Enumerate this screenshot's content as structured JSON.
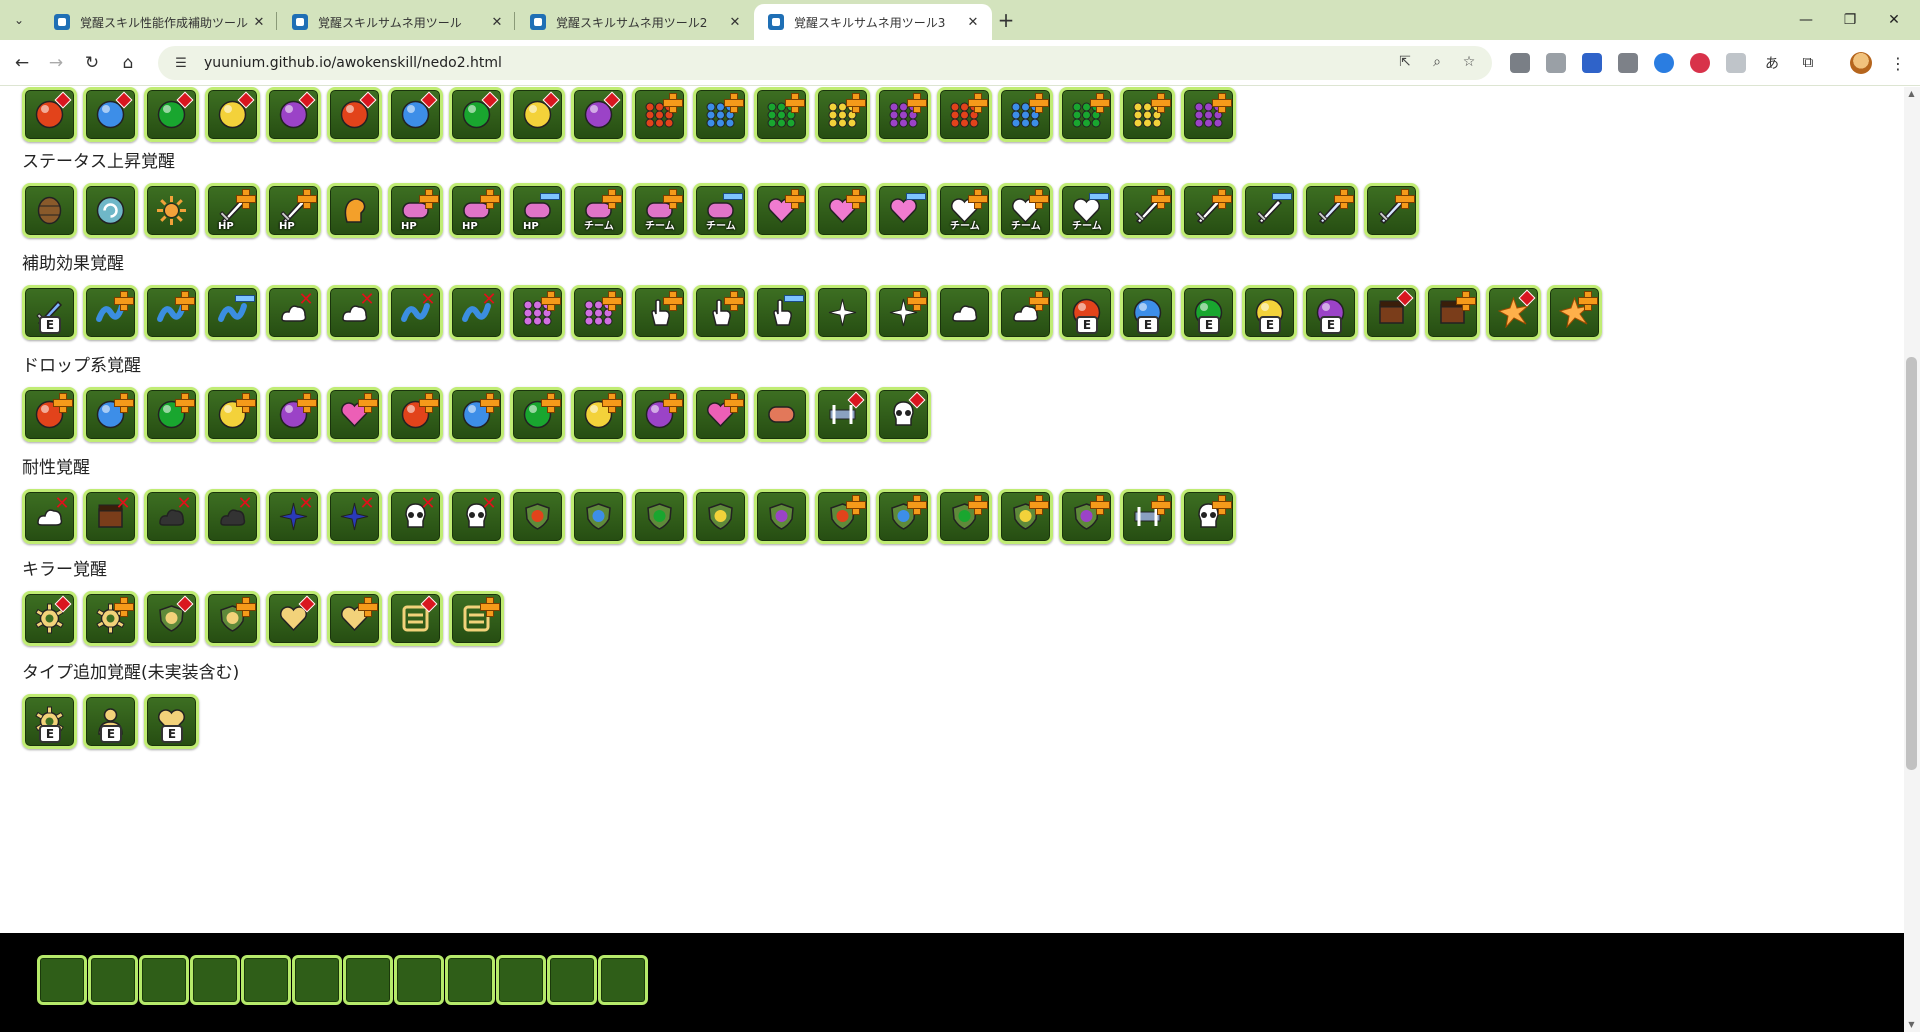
{
  "browser": {
    "tabs": [
      {
        "title": "覚醒スキル性能作成補助ツール",
        "active": false
      },
      {
        "title": "覚醒スキルサムネ用ツール",
        "active": false
      },
      {
        "title": "覚醒スキルサムネ用ツール2",
        "active": false
      },
      {
        "title": "覚醒スキルサムネ用ツール3",
        "active": true
      }
    ],
    "close_glyph": "✕",
    "new_tab_glyph": "+",
    "url": "yuunium.github.io/awokenskill/nedo2.html",
    "icons": [
      "back-icon",
      "forward-icon",
      "reload-icon",
      "home-icon",
      "site-info-icon",
      "open-in-app-icon",
      "zoom-icon",
      "bookmark-star-icon",
      "extensions-icon",
      "profile-avatar",
      "more-menu-icon"
    ],
    "window_controls": [
      "—",
      "❐",
      "✕"
    ]
  },
  "sections": [
    {
      "title": "",
      "key": "top",
      "icons": [
        {
          "kind": "orb",
          "color": "#e2431b",
          "mark": "diamond"
        },
        {
          "kind": "orb",
          "color": "#3d8ee8",
          "mark": "diamond"
        },
        {
          "kind": "orb",
          "color": "#19a62f",
          "mark": "diamond"
        },
        {
          "kind": "orb",
          "color": "#f3d23a",
          "mark": "diamond"
        },
        {
          "kind": "orb",
          "color": "#9b43c7",
          "mark": "diamond"
        },
        {
          "kind": "orb",
          "color": "#e2431b",
          "mark": "diamond"
        },
        {
          "kind": "orb",
          "color": "#3d8ee8",
          "mark": "diamond"
        },
        {
          "kind": "orb",
          "color": "#19a62f",
          "mark": "diamond"
        },
        {
          "kind": "orb",
          "color": "#f3d23a",
          "mark": "diamond"
        },
        {
          "kind": "orb",
          "color": "#9b43c7",
          "mark": "diamond"
        },
        {
          "kind": "dots",
          "color": "#e2431b",
          "mark": "plus"
        },
        {
          "kind": "dots",
          "color": "#3d8ee8",
          "mark": "plus"
        },
        {
          "kind": "dots",
          "color": "#19a62f",
          "mark": "plus"
        },
        {
          "kind": "dots",
          "color": "#f3d23a",
          "mark": "plus"
        },
        {
          "kind": "dots",
          "color": "#9b43c7",
          "mark": "plus"
        },
        {
          "kind": "dots",
          "color": "#e2431b",
          "mark": "plus"
        },
        {
          "kind": "dots",
          "color": "#3d8ee8",
          "mark": "plus"
        },
        {
          "kind": "dots",
          "color": "#19a62f",
          "mark": "plus"
        },
        {
          "kind": "dots",
          "color": "#f3d23a",
          "mark": "plus"
        },
        {
          "kind": "dots",
          "color": "#9b43c7",
          "mark": "plus"
        }
      ]
    },
    {
      "title": "ステータス上昇覚醒",
      "key": "status",
      "icons": [
        {
          "kind": "barrel",
          "color": "#8a5a2b",
          "mark": ""
        },
        {
          "kind": "swirl",
          "color": "#6fb7c8",
          "mark": ""
        },
        {
          "kind": "sun",
          "color": "#f2a23a",
          "mark": ""
        },
        {
          "kind": "sword",
          "color": "#ffffff",
          "mark": "plus",
          "badge": "HP"
        },
        {
          "kind": "sword",
          "color": "#ffffff",
          "mark": "plus",
          "badge": "HP"
        },
        {
          "kind": "head",
          "color": "#f3a02a",
          "mark": ""
        },
        {
          "kind": "pill",
          "color": "#e074c8",
          "mark": "plus",
          "badge": "HP"
        },
        {
          "kind": "pill",
          "color": "#e074c8",
          "mark": "plus",
          "badge": "HP"
        },
        {
          "kind": "pill",
          "color": "#e074c8",
          "mark": "minus",
          "badge": "HP"
        },
        {
          "kind": "pill",
          "color": "#e074c8",
          "mark": "plus",
          "badge": "チーム"
        },
        {
          "kind": "pill",
          "color": "#e074c8",
          "mark": "plus",
          "badge": "チーム"
        },
        {
          "kind": "pill",
          "color": "#e074c8",
          "mark": "minus",
          "badge": "チーム"
        },
        {
          "kind": "heart",
          "color": "#f07bd0",
          "mark": "plus"
        },
        {
          "kind": "heart",
          "color": "#f07bd0",
          "mark": "plus"
        },
        {
          "kind": "heart",
          "color": "#f07bd0",
          "mark": "minus"
        },
        {
          "kind": "heart",
          "color": "#ffffff",
          "mark": "plus",
          "badge": "チーム"
        },
        {
          "kind": "heart",
          "color": "#ffffff",
          "mark": "plus",
          "badge": "チーム"
        },
        {
          "kind": "heart",
          "color": "#ffffff",
          "mark": "minus",
          "badge": "チーム"
        },
        {
          "kind": "sword",
          "color": "#ffffff",
          "mark": "plus"
        },
        {
          "kind": "sword",
          "color": "#ffffff",
          "mark": "plus"
        },
        {
          "kind": "sword",
          "color": "#ffffff",
          "mark": "minus"
        },
        {
          "kind": "sword",
          "color": "#d7e6ff",
          "mark": "plus"
        },
        {
          "kind": "sword",
          "color": "#d7e6ff",
          "mark": "plus"
        }
      ]
    },
    {
      "title": "補助効果覚醒",
      "key": "support",
      "icons": [
        {
          "kind": "sword",
          "color": "#7fb4ff",
          "mark": "",
          "ebadge": "E"
        },
        {
          "kind": "wave",
          "color": "#3b8ee0",
          "mark": "plus"
        },
        {
          "kind": "wave",
          "color": "#3b8ee0",
          "mark": "plus"
        },
        {
          "kind": "wave",
          "color": "#3b8ee0",
          "mark": "minus"
        },
        {
          "kind": "cloud",
          "color": "#ffffff",
          "mark": "cross"
        },
        {
          "kind": "cloud",
          "color": "#ffffff",
          "mark": "cross"
        },
        {
          "kind": "wave",
          "color": "#3b8ee0",
          "mark": "cross"
        },
        {
          "kind": "wave",
          "color": "#3b8ee0",
          "mark": "cross"
        },
        {
          "kind": "dots",
          "color": "#d16fe0",
          "mark": "plus"
        },
        {
          "kind": "dots",
          "color": "#d16fe0",
          "mark": "plus"
        },
        {
          "kind": "hand",
          "color": "#ffffff",
          "mark": "plus"
        },
        {
          "kind": "hand",
          "color": "#ffffff",
          "mark": "plus"
        },
        {
          "kind": "hand",
          "color": "#ffffff",
          "mark": "minus"
        },
        {
          "kind": "spark",
          "color": "#ffffff",
          "mark": ""
        },
        {
          "kind": "spark",
          "color": "#ffffff",
          "mark": "plus"
        },
        {
          "kind": "cloud",
          "color": "#ffffff",
          "mark": ""
        },
        {
          "kind": "cloud",
          "color": "#ffffff",
          "mark": "plus"
        },
        {
          "kind": "orb",
          "color": "#e2431b",
          "mark": "",
          "ebadge": "E"
        },
        {
          "kind": "orb",
          "color": "#3d8ee8",
          "mark": "",
          "ebadge": "E"
        },
        {
          "kind": "orb",
          "color": "#19a62f",
          "mark": "",
          "ebadge": "E"
        },
        {
          "kind": "orb",
          "color": "#f3d23a",
          "mark": "",
          "ebadge": "E"
        },
        {
          "kind": "orb",
          "color": "#9b43c7",
          "mark": "",
          "ebadge": "E"
        },
        {
          "kind": "box",
          "color": "#7a3d1a",
          "mark": "diamond"
        },
        {
          "kind": "box",
          "color": "#7a3d1a",
          "mark": "plus"
        },
        {
          "kind": "burst",
          "color": "#ffb04a",
          "mark": "diamond"
        },
        {
          "kind": "burst",
          "color": "#ffb04a",
          "mark": "plus"
        }
      ]
    },
    {
      "title": "ドロップ系覚醒",
      "key": "drop",
      "icons": [
        {
          "kind": "orb",
          "color": "#e2431b",
          "mark": "plus"
        },
        {
          "kind": "orb",
          "color": "#3d8ee8",
          "mark": "plus"
        },
        {
          "kind": "orb",
          "color": "#19a62f",
          "mark": "plus"
        },
        {
          "kind": "orb",
          "color": "#f3d23a",
          "mark": "plus"
        },
        {
          "kind": "orb",
          "color": "#9b43c7",
          "mark": "plus"
        },
        {
          "kind": "heart",
          "color": "#ec5fb6",
          "mark": "plus"
        },
        {
          "kind": "orb",
          "color": "#e2431b",
          "mark": "plus"
        },
        {
          "kind": "orb",
          "color": "#3d8ee8",
          "mark": "plus"
        },
        {
          "kind": "orb",
          "color": "#19a62f",
          "mark": "plus"
        },
        {
          "kind": "orb",
          "color": "#f3d23a",
          "mark": "plus"
        },
        {
          "kind": "orb",
          "color": "#9b43c7",
          "mark": "plus"
        },
        {
          "kind": "heart",
          "color": "#ec5fb6",
          "mark": "plus"
        },
        {
          "kind": "pill",
          "color": "#e2785a",
          "mark": ""
        },
        {
          "kind": "bar",
          "color": "#ffffff",
          "mark": "diamond"
        },
        {
          "kind": "skull",
          "color": "#ffffff",
          "mark": "diamond"
        }
      ]
    },
    {
      "title": "耐性覚醒",
      "key": "resist",
      "icons": [
        {
          "kind": "cloud",
          "color": "#ffffff",
          "mark": "cross"
        },
        {
          "kind": "box",
          "color": "#7a3d1a",
          "mark": "cross"
        },
        {
          "kind": "cloud",
          "color": "#333333",
          "mark": "cross"
        },
        {
          "kind": "cloud",
          "color": "#333333",
          "mark": "cross"
        },
        {
          "kind": "spark",
          "color": "#2a3ab8",
          "mark": "cross"
        },
        {
          "kind": "spark",
          "color": "#2a3ab8",
          "mark": "cross"
        },
        {
          "kind": "skull",
          "color": "#ffffff",
          "mark": "cross"
        },
        {
          "kind": "skull",
          "color": "#ffffff",
          "mark": "cross"
        },
        {
          "kind": "shield",
          "color": "#e2431b",
          "mark": ""
        },
        {
          "kind": "shield",
          "color": "#3d8ee8",
          "mark": ""
        },
        {
          "kind": "shield",
          "color": "#19a62f",
          "mark": ""
        },
        {
          "kind": "shield",
          "color": "#f3d23a",
          "mark": ""
        },
        {
          "kind": "shield",
          "color": "#9b43c7",
          "mark": ""
        },
        {
          "kind": "shield",
          "color": "#e2431b",
          "mark": "plus"
        },
        {
          "kind": "shield",
          "color": "#3d8ee8",
          "mark": "plus"
        },
        {
          "kind": "shield",
          "color": "#19a62f",
          "mark": "plus"
        },
        {
          "kind": "shield",
          "color": "#f3d23a",
          "mark": "plus"
        },
        {
          "kind": "shield",
          "color": "#9b43c7",
          "mark": "plus"
        },
        {
          "kind": "bar",
          "color": "#ffffff",
          "mark": "plus"
        },
        {
          "kind": "skull",
          "color": "#ffffff",
          "mark": "plus"
        }
      ]
    },
    {
      "title": "キラー覚醒",
      "key": "killer",
      "icons": [
        {
          "kind": "gear",
          "color": "#f2d27a",
          "mark": "diamond"
        },
        {
          "kind": "gear",
          "color": "#f2d27a",
          "mark": "plus"
        },
        {
          "kind": "shield",
          "color": "#f2d27a",
          "mark": "diamond"
        },
        {
          "kind": "shield",
          "color": "#f2d27a",
          "mark": "plus"
        },
        {
          "kind": "heart",
          "color": "#f2d27a",
          "mark": "diamond"
        },
        {
          "kind": "heart",
          "color": "#f2d27a",
          "mark": "plus"
        },
        {
          "kind": "kanji",
          "color": "#f2d27a",
          "mark": "diamond"
        },
        {
          "kind": "kanji",
          "color": "#f2d27a",
          "mark": "plus"
        }
      ]
    },
    {
      "title": "タイプ追加覚醒(未実装含む)",
      "key": "type",
      "icons": [
        {
          "kind": "gear",
          "color": "#f2d27a",
          "mark": "",
          "ebadge": "E"
        },
        {
          "kind": "person",
          "color": "#f2d27a",
          "mark": "",
          "ebadge": "E"
        },
        {
          "kind": "heart",
          "color": "#f2d27a",
          "mark": "",
          "ebadge": "E"
        }
      ]
    }
  ],
  "bottom_slots": 12
}
